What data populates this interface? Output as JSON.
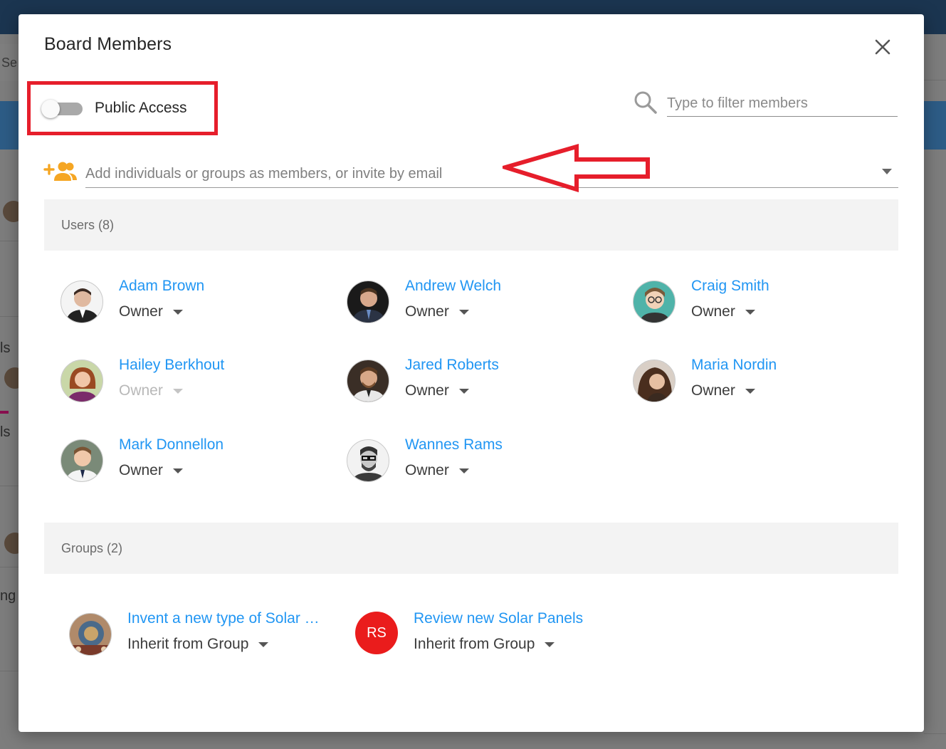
{
  "background": {
    "search_fragment": "Se",
    "text_fragments": [
      "ls",
      "ls",
      "ng"
    ]
  },
  "modal": {
    "title": "Board Members",
    "public_access_label": "Public Access",
    "public_access_enabled": false,
    "filter_placeholder": "Type to filter members",
    "add_placeholder": "Add individuals or groups as members, or invite by email"
  },
  "users_section": {
    "header": "Users (8)",
    "members": [
      {
        "name": "Adam Brown",
        "role": "Owner",
        "disabled": false
      },
      {
        "name": "Andrew Welch",
        "role": "Owner",
        "disabled": false
      },
      {
        "name": "Craig Smith",
        "role": "Owner",
        "disabled": false
      },
      {
        "name": "Hailey Berkhout",
        "role": "Owner",
        "disabled": true
      },
      {
        "name": "Jared Roberts",
        "role": "Owner",
        "disabled": false
      },
      {
        "name": "Maria Nordin",
        "role": "Owner",
        "disabled": false
      },
      {
        "name": "Mark Donnellon",
        "role": "Owner",
        "disabled": false
      },
      {
        "name": "Wannes Rams",
        "role": "Owner",
        "disabled": false
      }
    ]
  },
  "groups_section": {
    "header": "Groups (2)",
    "groups": [
      {
        "name": "Invent a new type of Solar …",
        "role": "Inherit from Group"
      },
      {
        "name": "Review new Solar Panels",
        "role": "Inherit from Group",
        "initials": "RS"
      }
    ]
  },
  "colors": {
    "accent": "#2196f3",
    "highlight": "#e61e2b",
    "add_icon": "#f5a623",
    "group_avatar": "#ea1c1c"
  }
}
